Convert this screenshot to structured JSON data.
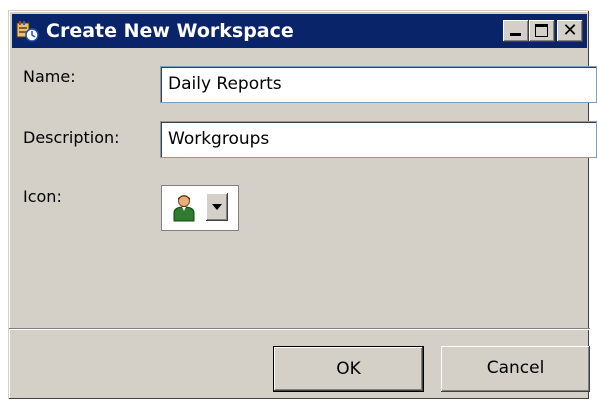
{
  "window": {
    "title": "Create New Workspace",
    "title_icon": "workspace-icon",
    "controls": {
      "minimize": "minimize-icon",
      "maximize": "maximize-icon",
      "close": "close-icon",
      "close_glyph": "✕"
    }
  },
  "form": {
    "name_label": "Name:",
    "name_value": "Daily Reports",
    "description_label": "Description:",
    "description_value": "Workgroups",
    "icon_label": "Icon:",
    "icon_selected": "person-icon"
  },
  "buttons": {
    "ok": "OK",
    "cancel": "Cancel"
  },
  "colors": {
    "titlebar": "#0a246a",
    "dialog_bg": "#d4d0c8"
  }
}
